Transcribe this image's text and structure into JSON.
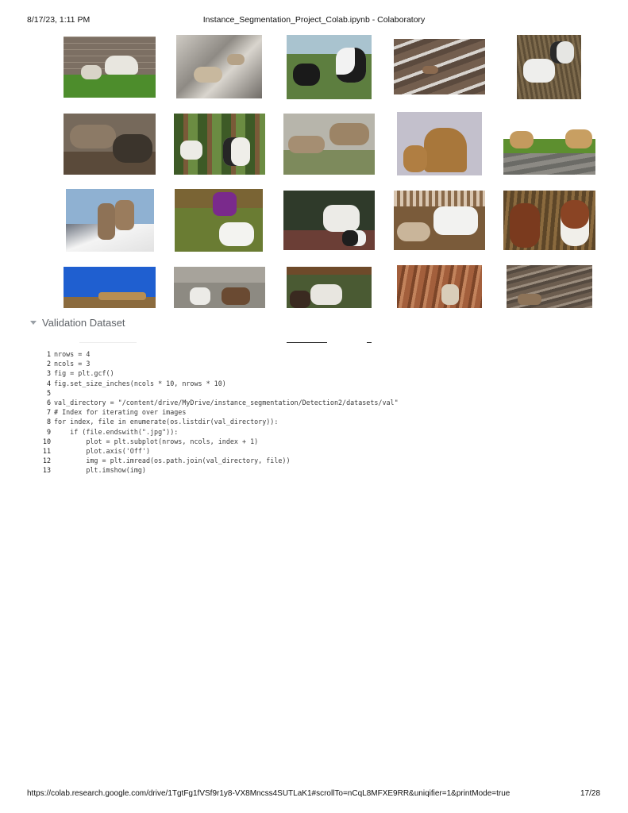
{
  "header": {
    "datetime": "8/17/23, 1:11 PM",
    "document_title": "Instance_Segmentation_Project_Colab.ipynb - Colaboratory"
  },
  "section": {
    "title": "Validation Dataset"
  },
  "code_cell": {
    "lines": [
      {
        "num": "1",
        "text": "nrows = 4"
      },
      {
        "num": "2",
        "text": "ncols = 3"
      },
      {
        "num": "3",
        "text": "fig = plt.gcf()"
      },
      {
        "num": "4",
        "text": "fig.set_size_inches(ncols * 10, nrows * 10)"
      },
      {
        "num": "5",
        "text": ""
      },
      {
        "num": "6",
        "text": "val_directory = \"/content/drive/MyDrive/instance_segmentation/Detection2/datasets/val\""
      },
      {
        "num": "7",
        "text": "# Index for iterating over images"
      },
      {
        "num": "8",
        "text": "for index, file in enumerate(os.listdir(val_directory)):"
      },
      {
        "num": "9",
        "text": "    if (file.endswith(\".jpg\")):"
      },
      {
        "num": "10",
        "text": "        plot = plt.subplot(nrows, ncols, index + 1)"
      },
      {
        "num": "11",
        "text": "        plot.axis('Off')"
      },
      {
        "num": "12",
        "text": "        img = plt.imread(os.path.join(val_directory, file))"
      },
      {
        "num": "13",
        "text": "        plt.imshow(img)"
      }
    ]
  },
  "footer": {
    "url": "https://colab.research.google.com/drive/1TgtFg1fVSf9r1y8-VX8Mncss4SUTLaK1#scrollTo=nCqL8MFXE9RR&uniqifier=1&printMode=true",
    "page_indicator": "17/28"
  },
  "image_grid": {
    "rows": 4,
    "cols": 5,
    "image_subject": "goat photographs"
  }
}
